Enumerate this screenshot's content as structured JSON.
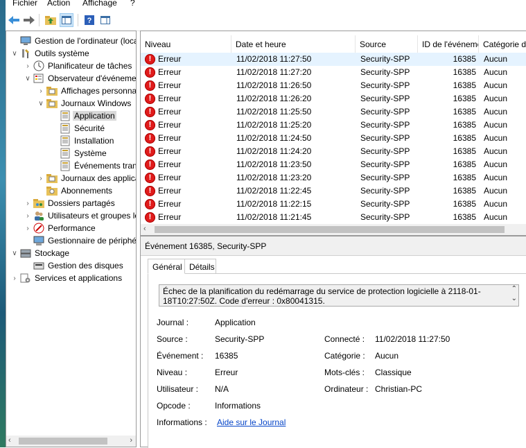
{
  "menu": [
    "Fichier",
    "Action",
    "Affichage",
    "?"
  ],
  "tree": {
    "items": [
      {
        "label": "Gestion de l'ordinateur (local)",
        "depth": 0,
        "arrow": "",
        "icon": "computer-mgmt-icon"
      },
      {
        "label": "Outils système",
        "depth": 0,
        "arrow": "v",
        "icon": "tools-icon"
      },
      {
        "label": "Planificateur de tâches",
        "depth": 1,
        "arrow": ">",
        "icon": "clock-icon"
      },
      {
        "label": "Observateur d'événements",
        "depth": 1,
        "arrow": "v",
        "icon": "event-viewer-icon"
      },
      {
        "label": "Affichages personnalisés",
        "depth": 2,
        "arrow": ">",
        "icon": "folder-icon"
      },
      {
        "label": "Journaux Windows",
        "depth": 2,
        "arrow": "v",
        "icon": "folder-icon"
      },
      {
        "label": "Application",
        "depth": 3,
        "arrow": "",
        "icon": "log-icon",
        "selected": true
      },
      {
        "label": "Sécurité",
        "depth": 3,
        "arrow": "",
        "icon": "log-icon"
      },
      {
        "label": "Installation",
        "depth": 3,
        "arrow": "",
        "icon": "log-icon"
      },
      {
        "label": "Système",
        "depth": 3,
        "arrow": "",
        "icon": "log-icon"
      },
      {
        "label": "Événements transférés",
        "depth": 3,
        "arrow": "",
        "icon": "log-icon"
      },
      {
        "label": "Journaux des applications",
        "depth": 2,
        "arrow": ">",
        "icon": "folder-icon"
      },
      {
        "label": "Abonnements",
        "depth": 2,
        "arrow": "",
        "icon": "subscription-icon"
      },
      {
        "label": "Dossiers partagés",
        "depth": 1,
        "arrow": ">",
        "icon": "shared-folder-icon"
      },
      {
        "label": "Utilisateurs et groupes locaux",
        "depth": 1,
        "arrow": ">",
        "icon": "users-icon"
      },
      {
        "label": "Performance",
        "depth": 1,
        "arrow": ">",
        "icon": "performance-icon"
      },
      {
        "label": "Gestionnaire de périphériques",
        "depth": 1,
        "arrow": "",
        "icon": "device-manager-icon"
      },
      {
        "label": "Stockage",
        "depth": 0,
        "arrow": "v",
        "icon": "storage-icon"
      },
      {
        "label": "Gestion des disques",
        "depth": 1,
        "arrow": "",
        "icon": "disk-icon"
      },
      {
        "label": "Services et applications",
        "depth": 0,
        "arrow": ">",
        "icon": "services-icon"
      }
    ]
  },
  "list": {
    "columns": [
      "Niveau",
      "Date et heure",
      "Source",
      "ID de l'événement",
      "Catégorie de la tâche"
    ],
    "rows": [
      {
        "level": "Erreur",
        "date": "11/02/2018 11:27:50",
        "source": "Security-SPP",
        "id": "16385",
        "cat": "Aucun"
      },
      {
        "level": "Erreur",
        "date": "11/02/2018 11:27:20",
        "source": "Security-SPP",
        "id": "16385",
        "cat": "Aucun"
      },
      {
        "level": "Erreur",
        "date": "11/02/2018 11:26:50",
        "source": "Security-SPP",
        "id": "16385",
        "cat": "Aucun"
      },
      {
        "level": "Erreur",
        "date": "11/02/2018 11:26:20",
        "source": "Security-SPP",
        "id": "16385",
        "cat": "Aucun"
      },
      {
        "level": "Erreur",
        "date": "11/02/2018 11:25:50",
        "source": "Security-SPP",
        "id": "16385",
        "cat": "Aucun"
      },
      {
        "level": "Erreur",
        "date": "11/02/2018 11:25:20",
        "source": "Security-SPP",
        "id": "16385",
        "cat": "Aucun"
      },
      {
        "level": "Erreur",
        "date": "11/02/2018 11:24:50",
        "source": "Security-SPP",
        "id": "16385",
        "cat": "Aucun"
      },
      {
        "level": "Erreur",
        "date": "11/02/2018 11:24:20",
        "source": "Security-SPP",
        "id": "16385",
        "cat": "Aucun"
      },
      {
        "level": "Erreur",
        "date": "11/02/2018 11:23:50",
        "source": "Security-SPP",
        "id": "16385",
        "cat": "Aucun"
      },
      {
        "level": "Erreur",
        "date": "11/02/2018 11:23:20",
        "source": "Security-SPP",
        "id": "16385",
        "cat": "Aucun"
      },
      {
        "level": "Erreur",
        "date": "11/02/2018 11:22:45",
        "source": "Security-SPP",
        "id": "16385",
        "cat": "Aucun"
      },
      {
        "level": "Erreur",
        "date": "11/02/2018 11:22:15",
        "source": "Security-SPP",
        "id": "16385",
        "cat": "Aucun"
      },
      {
        "level": "Erreur",
        "date": "11/02/2018 11:21:45",
        "source": "Security-SPP",
        "id": "16385",
        "cat": "Aucun"
      }
    ]
  },
  "detail": {
    "title": "Événement 16385, Security-SPP",
    "tab_general": "Général",
    "tab_details": "Détails",
    "message": "Échec de la planification du redémarrage du service de protection logicielle à 2118-01-18T10:27:50Z. Code d'erreur : 0x80041315.",
    "fields": {
      "journal_label": "Journal :",
      "journal": "Application",
      "source_label": "Source :",
      "source": "Security-SPP",
      "connecte_label": "Connecté :",
      "connecte": "11/02/2018 11:27:50",
      "evenement_label": "Événement :",
      "evenement": "16385",
      "categorie_label": "Catégorie :",
      "categorie": "Aucun",
      "niveau_label": "Niveau :",
      "niveau": "Erreur",
      "motscles_label": "Mots-clés :",
      "motscles": "Classique",
      "utilisateur_label": "Utilisateur :",
      "utilisateur": "N/A",
      "ordinateur_label": "Ordinateur :",
      "ordinateur": "Christian-PC",
      "opcode_label": "Opcode :",
      "opcode": "Informations",
      "informations_label": "Informations :",
      "informations_link": "Aide sur le Journal"
    }
  },
  "colors": {
    "error": "#e01b1b",
    "selection": "#e5f3ff",
    "link": "#0645c8"
  }
}
